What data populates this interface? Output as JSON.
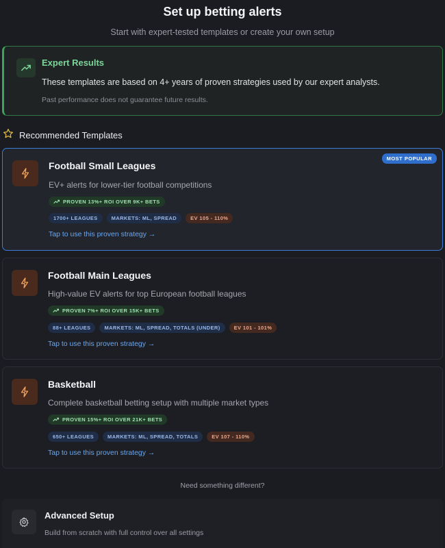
{
  "header": {
    "title": "Set up betting alerts",
    "subtitle": "Start with expert-tested templates or create your own setup"
  },
  "expert": {
    "icon": "trending-up-icon",
    "title": "Expert Results",
    "description": "These templates are based on 4+ years of proven strategies used by our expert analysts.",
    "disclaimer": "Past performance does not guarantee future results."
  },
  "recommended": {
    "icon": "star-icon",
    "label": "Recommended Templates"
  },
  "templates": [
    {
      "title": "Football Small Leagues",
      "description": "EV+ alerts for lower-tier football competitions",
      "proven": "PROVEN 13%+ ROI OVER 9K+ BETS",
      "leagues": "1700+ LEAGUES",
      "markets": "MARKETS: ML, SPREAD",
      "ev": "EV 105 - 110%",
      "link": "Tap to use this proven strategy →",
      "badge": "MOST POPULAR"
    },
    {
      "title": "Football Main Leagues",
      "description": "High-value EV alerts for top European football leagues",
      "proven": "PROVEN 7%+ ROI OVER 15K+ BETS",
      "leagues": "88+ LEAGUES",
      "markets": "MARKETS: ML, SPREAD, TOTALS (UNDER)",
      "ev": "EV 101 - 101%",
      "link": "Tap to use this proven strategy →"
    },
    {
      "title": "Basketball",
      "description": "Complete basketball betting setup with multiple market types",
      "proven": "PROVEN 15%+ ROI OVER 21K+ BETS",
      "leagues": "650+ LEAGUES",
      "markets": "MARKETS: ML, SPREAD, TOTALS",
      "ev": "EV 107 - 110%",
      "link": "Tap to use this proven strategy →"
    }
  ],
  "need_different": "Need something different?",
  "advanced": {
    "icon": "gear-icon",
    "title": "Advanced Setup",
    "description": "Build from scratch with full control over all settings"
  },
  "colors": {
    "background": "#1b1c21",
    "accent_blue": "#3d7fd8",
    "accent_green": "#3aa65c",
    "lightning_orange": "#f0a35e"
  }
}
